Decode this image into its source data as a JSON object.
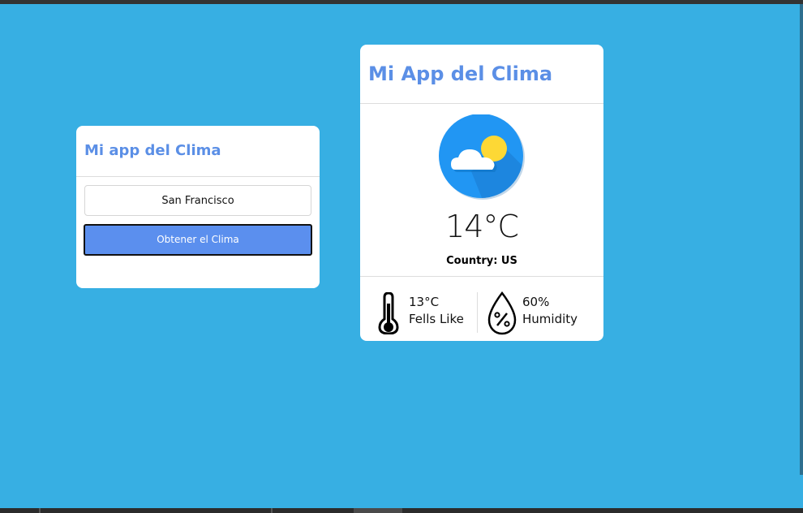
{
  "search_card": {
    "title": "Mi app del Clima",
    "city_value": "San Francisco",
    "button_label": "Obtener el Clima"
  },
  "weather_card": {
    "title": "Mi App del Clima",
    "icon": "partly-cloudy-icon",
    "temperature": "14°C",
    "country": "Country: US",
    "feels_like": {
      "value": "13°C",
      "label": "Fells Like",
      "icon": "thermometer-icon"
    },
    "humidity": {
      "value": "60%",
      "label": "Humidity",
      "icon": "humidity-drop-icon"
    }
  },
  "colors": {
    "background": "#37afe3",
    "accent": "#5b8fe6",
    "button": "#5b8fee",
    "icon_circle": "#2196f3",
    "sun": "#fdd835"
  }
}
